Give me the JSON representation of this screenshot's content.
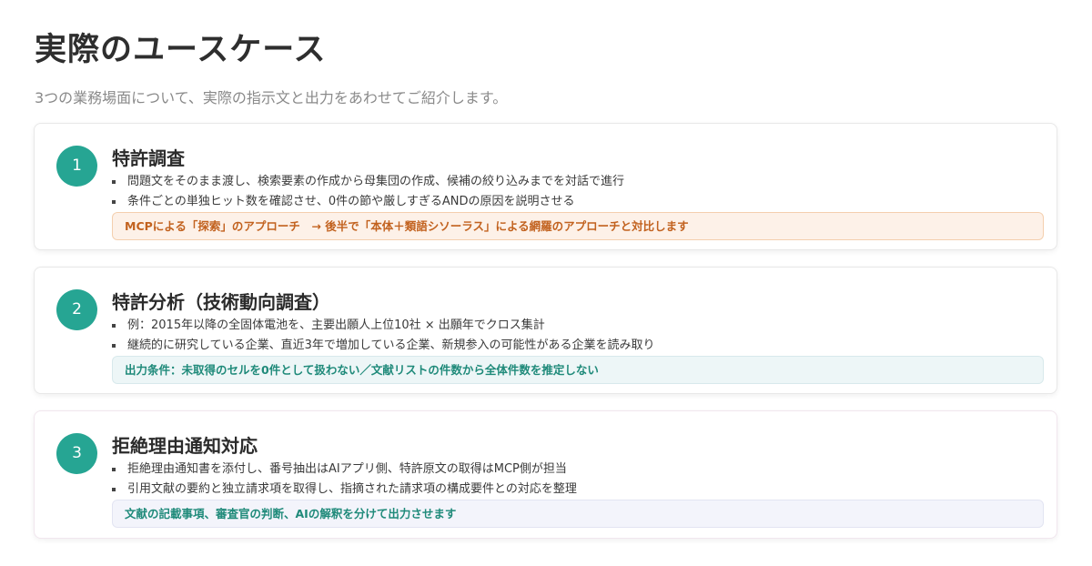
{
  "page": {
    "title": "実際のユースケース",
    "subtitle": "3つの業務場面について、実際の指示文と出力をあわせてご紹介します。"
  },
  "colors": {
    "accent": "#26a593",
    "note_orange_text": "#c2621f",
    "note_teal_text": "#1f8a7a"
  },
  "cases": [
    {
      "number": "1",
      "title": "特許調査",
      "bullets": [
        "問題文をそのまま渡し、検索要素の作成から母集団の作成、候補の絞り込みまでを対話で進行",
        "条件ごとの単独ヒット数を確認させ、0件の節や厳しすぎるANDの原因を説明させる"
      ],
      "note": "MCPによる「探索」のアプローチ　→ 後半で「本体＋類語シソーラス」による網羅のアプローチと対比します"
    },
    {
      "number": "2",
      "title": "特許分析（技術動向調査）",
      "bullets": [
        "例：2015年以降の全固体電池を、主要出願人上位10社 × 出願年でクロス集計",
        "継続的に研究している企業、直近3年で増加している企業、新規参入の可能性がある企業を読み取り"
      ],
      "note": "出力条件：未取得のセルを0件として扱わない／文献リストの件数から全体件数を推定しない"
    },
    {
      "number": "3",
      "title": "拒絶理由通知対応",
      "bullets": [
        "拒絶理由通知書を添付し、番号抽出はAIアプリ側、特許原文の取得はMCP側が担当",
        "引用文献の要約と独立請求項を取得し、指摘された請求項の構成要件との対応を整理"
      ],
      "note": "文献の記載事項、審査官の判断、AIの解釈を分けて出力させます"
    }
  ]
}
